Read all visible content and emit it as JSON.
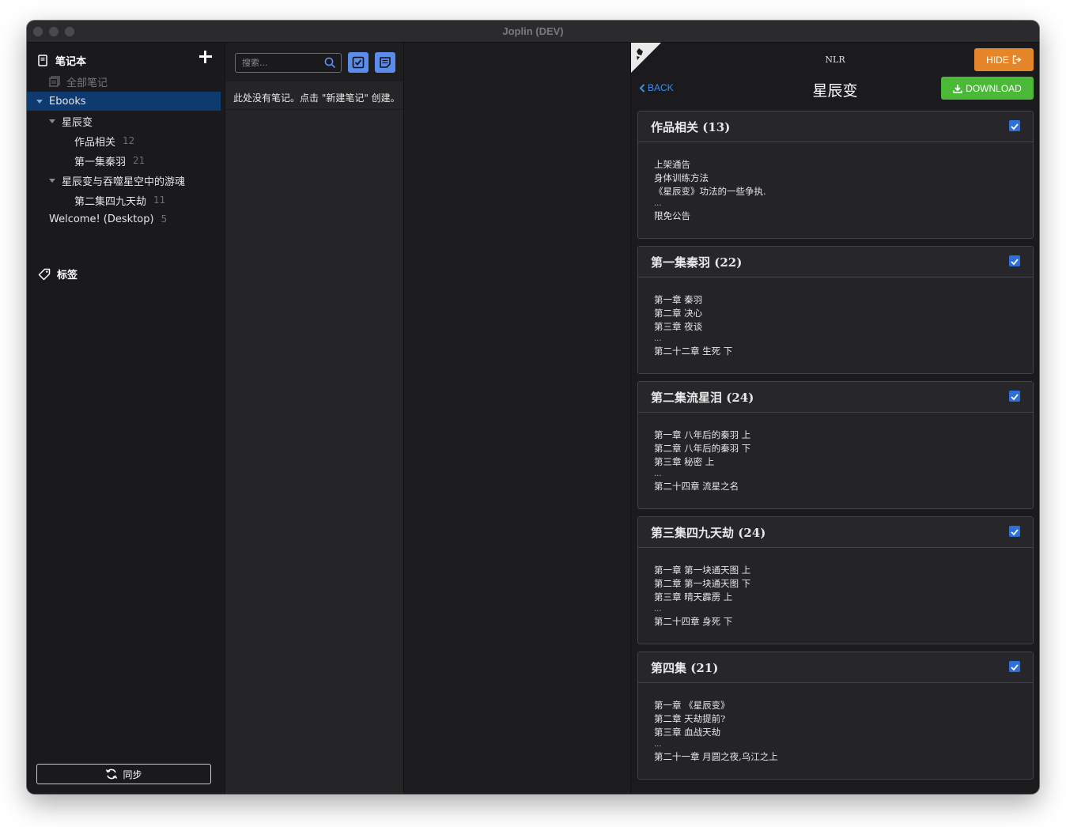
{
  "window": {
    "title": "Joplin (DEV)"
  },
  "sidebar": {
    "header": "笔记本",
    "all_notes": "全部笔记",
    "notebooks": [
      {
        "label": "Ebooks",
        "count": ""
      },
      {
        "label": "星辰变",
        "count": ""
      },
      {
        "label": "作品相关",
        "count": "12"
      },
      {
        "label": "第一集秦羽",
        "count": "21"
      },
      {
        "label": "星辰变与吞噬星空中的游魂",
        "count": ""
      },
      {
        "label": "第二集四九天劫",
        "count": "11"
      },
      {
        "label": "Welcome! (Desktop)",
        "count": "5"
      }
    ],
    "tags_label": "标签",
    "sync_label": "同步"
  },
  "notelist": {
    "search_placeholder": "搜索...",
    "empty_message": "此处没有笔记。点击 \"新建笔记\" 创建。"
  },
  "panel": {
    "source": "NLR",
    "hide_label": "HIDE",
    "back_label": "BACK",
    "title": "星辰变",
    "download_label": "DOWNLOAD",
    "volumes": [
      {
        "title": "作品相关 (13)",
        "checked": true,
        "lines": [
          "上架通告",
          "身体训练方法",
          "《星辰变》功法的一些争执.",
          "...",
          "限免公告"
        ]
      },
      {
        "title": "第一集秦羽 (22)",
        "checked": true,
        "lines": [
          "第一章 秦羽",
          "第二章 决心",
          "第三章 夜谈",
          "...",
          "第二十二章 生死 下"
        ]
      },
      {
        "title": "第二集流星泪 (24)",
        "checked": true,
        "lines": [
          "第一章 八年后的秦羽 上",
          "第二章 八年后的秦羽 下",
          "第三章 秘密 上",
          "...",
          "第二十四章 流星之名"
        ]
      },
      {
        "title": "第三集四九天劫 (24)",
        "checked": true,
        "lines": [
          "第一章 第一块通天图 上",
          "第二章 第一块通天图 下",
          "第三章 晴天霹雳 上",
          "...",
          "第二十四章 身死 下"
        ]
      },
      {
        "title": "第四集 (21)",
        "checked": true,
        "lines": [
          "第一章 《星辰变》",
          "第二章 天劫提前?",
          "第三章 血战天劫",
          "...",
          "第二十一章 月圆之夜,乌江之上"
        ]
      }
    ]
  },
  "colors": {
    "accent_blue": "#5b8cec",
    "selected_notebook": "#0e3a70",
    "hide_button": "#e6862a",
    "download_button": "#4ab938",
    "back_link": "#3f8cf0"
  }
}
